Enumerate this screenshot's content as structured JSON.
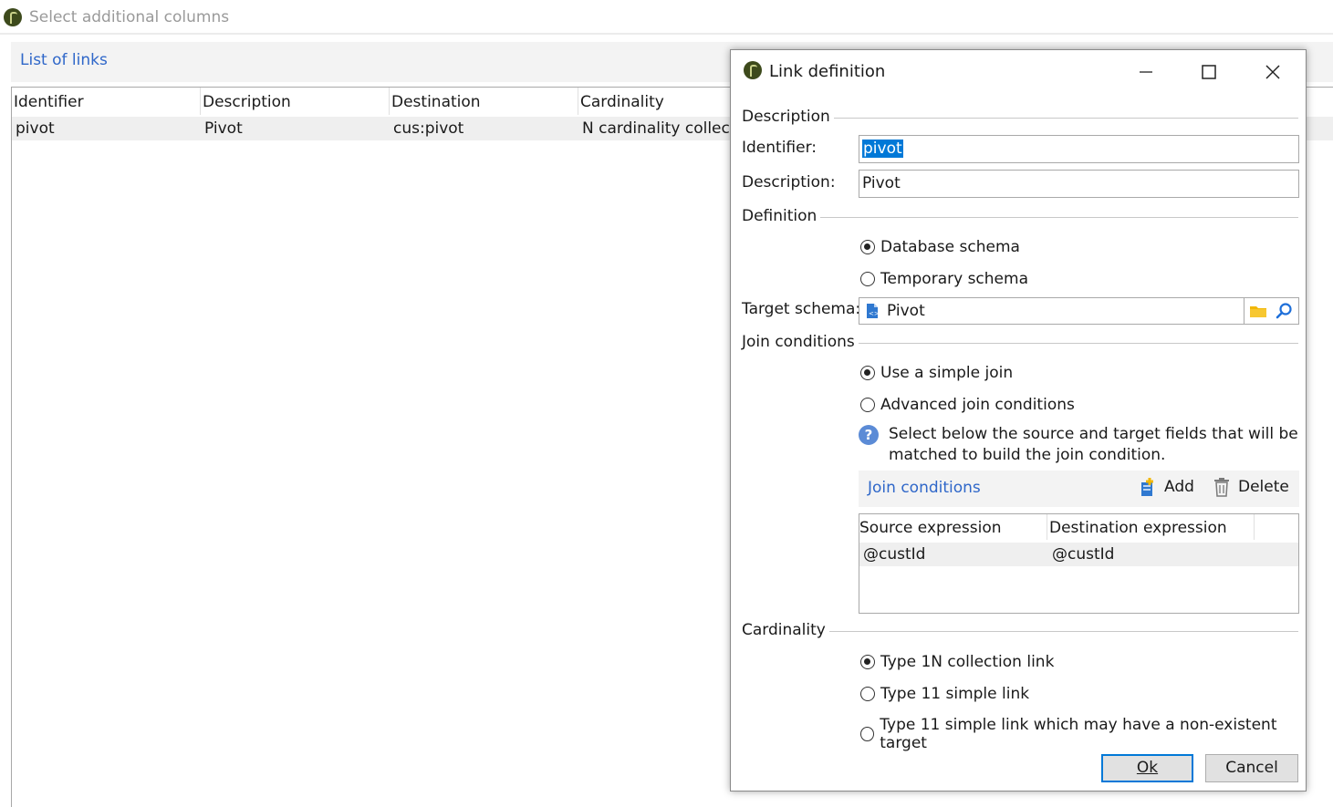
{
  "background": {
    "title": "Select additional columns",
    "section_label": "List of links",
    "columns": [
      "Identifier",
      "Description",
      "Destination",
      "Cardinality"
    ],
    "rows": [
      {
        "identifier": "pivot",
        "description": "Pivot",
        "destination": "cus:pivot",
        "cardinality": "N cardinality collecti"
      }
    ]
  },
  "dialog": {
    "title": "Link definition",
    "description_group": "Description",
    "identifier_label": "Identifier:",
    "identifier_value": "pivot",
    "description_label": "Description:",
    "description_value": "Pivot",
    "definition_group": "Definition",
    "schema_options": [
      "Database schema",
      "Temporary schema"
    ],
    "schema_selected": 0,
    "target_schema_label": "Target schema:",
    "target_schema_value": "Pivot",
    "join_group": "Join conditions",
    "join_options": [
      "Use a simple join",
      "Advanced join conditions"
    ],
    "join_selected": 0,
    "help_text_line1": "Select below the source and target fields that will be",
    "help_text_line2": "matched to build the join condition.",
    "join_toolbar_label": "Join conditions",
    "add_label": "Add",
    "delete_label": "Delete",
    "join_columns": [
      "Source expression",
      "Destination expression"
    ],
    "join_rows": [
      {
        "source": "@custId",
        "destination": "@custId"
      }
    ],
    "cardinality_group": "Cardinality",
    "cardinality_options": [
      "Type 1N collection link",
      "Type 11 simple link",
      "Type 11 simple link which may have a non-existent target"
    ],
    "cardinality_selected": 0,
    "ok_label": "Ok",
    "cancel_label": "Cancel"
  },
  "colors": {
    "accent_blue": "#2f67c9",
    "selection_blue": "#0078d7",
    "folder_yellow": "#f2b705"
  }
}
